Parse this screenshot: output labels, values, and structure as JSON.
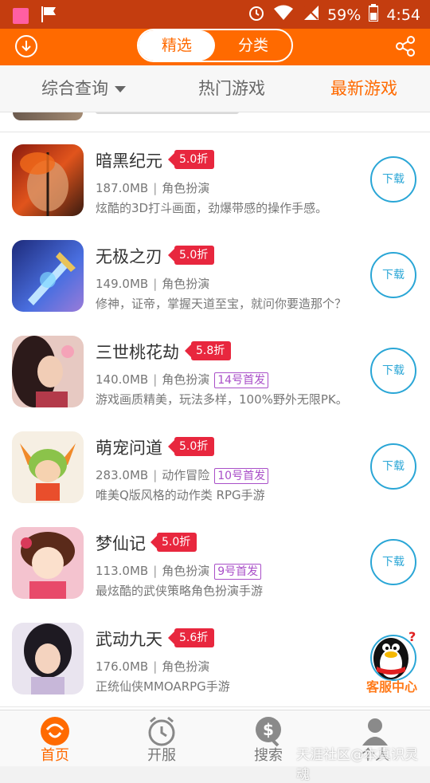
{
  "status_bar": {
    "battery": "59%",
    "time": "4:54"
  },
  "header": {
    "seg_selected": "精选",
    "seg_other": "分类"
  },
  "tabs": {
    "combined": "综合查询",
    "hot": "热门游戏",
    "latest": "最新游戏",
    "active": "最新游戏"
  },
  "games": [
    {
      "name": "暗黑纪元",
      "discount": "5.0折",
      "size": "187.0MB",
      "category": "角色扮演",
      "badge": "",
      "desc": "炫酷的3D打斗画面，劲爆带感的操作手感。",
      "download": "下载"
    },
    {
      "name": "无极之刃",
      "discount": "5.0折",
      "size": "149.0MB",
      "category": "角色扮演",
      "badge": "",
      "desc": "修神，证帝，掌握天道至宝，就问你要造那个？",
      "download": "下载"
    },
    {
      "name": "三世桃花劫",
      "discount": "5.8折",
      "size": "140.0MB",
      "category": "角色扮演",
      "badge": "14号首发",
      "desc": "游戏画质精美，玩法多样，100%野外无限PK。",
      "download": "下载"
    },
    {
      "name": "萌宠问道",
      "discount": "5.0折",
      "size": "283.0MB",
      "category": "动作冒险",
      "badge": "10号首发",
      "desc": "唯美Q版风格的动作类 RPG手游",
      "download": "下载"
    },
    {
      "name": "梦仙记",
      "discount": "5.0折",
      "size": "113.0MB",
      "category": "角色扮演",
      "badge": "9号首发",
      "desc": "最炫酷的武侠策略角色扮演手游",
      "download": "下载"
    },
    {
      "name": "武动九天",
      "discount": "5.6折",
      "size": "176.0MB",
      "category": "角色扮演",
      "badge": "",
      "desc": "正统仙侠MMOARPG手游",
      "download": "下载"
    }
  ],
  "floating": {
    "label": "客服中心"
  },
  "bottom_nav": [
    {
      "label": "首页",
      "icon": "home-icon",
      "active": true
    },
    {
      "label": "开服",
      "icon": "alarm-clock-icon",
      "active": false
    },
    {
      "label": "搜索",
      "icon": "dollar-search-icon",
      "active": false
    },
    {
      "label": "个人",
      "icon": "person-icon",
      "active": false
    }
  ],
  "watermark": "天涯社区@本真识灵魂",
  "colors": {
    "accent": "#ff6a00",
    "discount": "#e8273e",
    "download": "#2aa6d6",
    "badge": "#a94fc8"
  }
}
